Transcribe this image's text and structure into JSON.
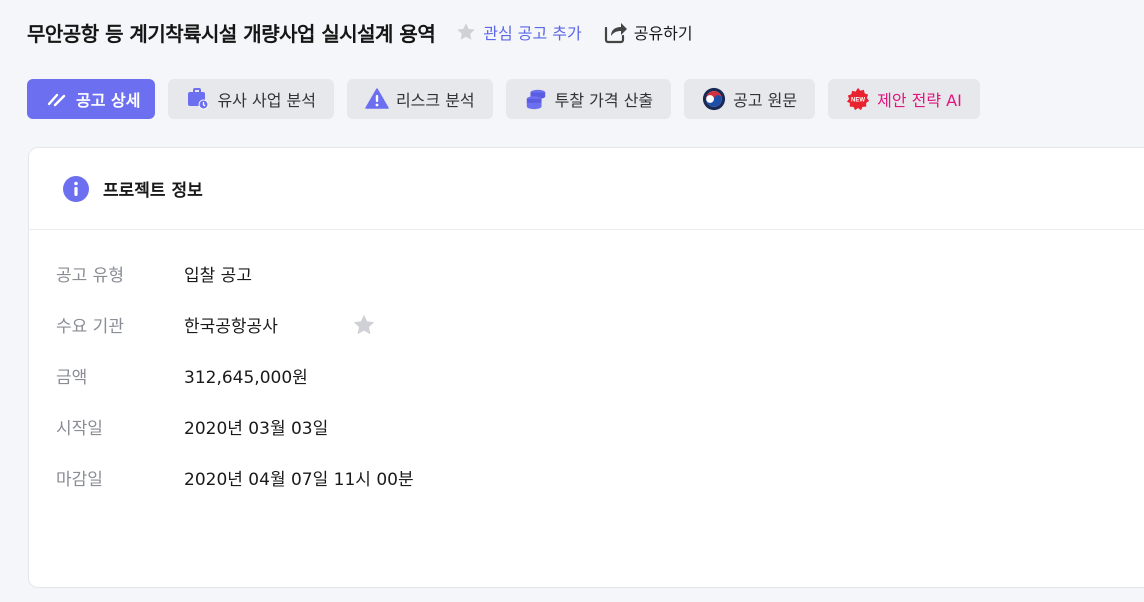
{
  "header": {
    "title": "무안공항 등 계기착륙시설 개량사업 실시설계 용역",
    "favorite_label": "관심 공고 추가",
    "share_label": "공유하기"
  },
  "tabs": [
    {
      "label": "공고 상세",
      "icon": "pencil-strokes-icon"
    },
    {
      "label": "유사 사업 분석",
      "icon": "briefcase-clock-icon"
    },
    {
      "label": "리스크 분석",
      "icon": "warning-triangle-icon"
    },
    {
      "label": "투찰 가격 산출",
      "icon": "coin-stack-icon"
    },
    {
      "label": "공고 원문",
      "icon": "taegeuk-icon"
    },
    {
      "label": "제안 전략 AI",
      "icon": "new-badge-icon"
    }
  ],
  "card": {
    "title": "프로젝트 정보",
    "rows": [
      {
        "label": "공고 유형",
        "value": "입찰 공고"
      },
      {
        "label": "수요 기관",
        "value": "한국공항공사"
      },
      {
        "label": "금액",
        "value": "312,645,000원"
      },
      {
        "label": "시작일",
        "value": "2020년 03월 03일"
      },
      {
        "label": "마감일",
        "value": "2020년 04월 07일 11시 00분"
      }
    ]
  },
  "colors": {
    "accent": "#6c6ff0",
    "link": "#5b67e6",
    "ai_text": "#e0157d",
    "tab_bg": "#e7e8ec"
  }
}
